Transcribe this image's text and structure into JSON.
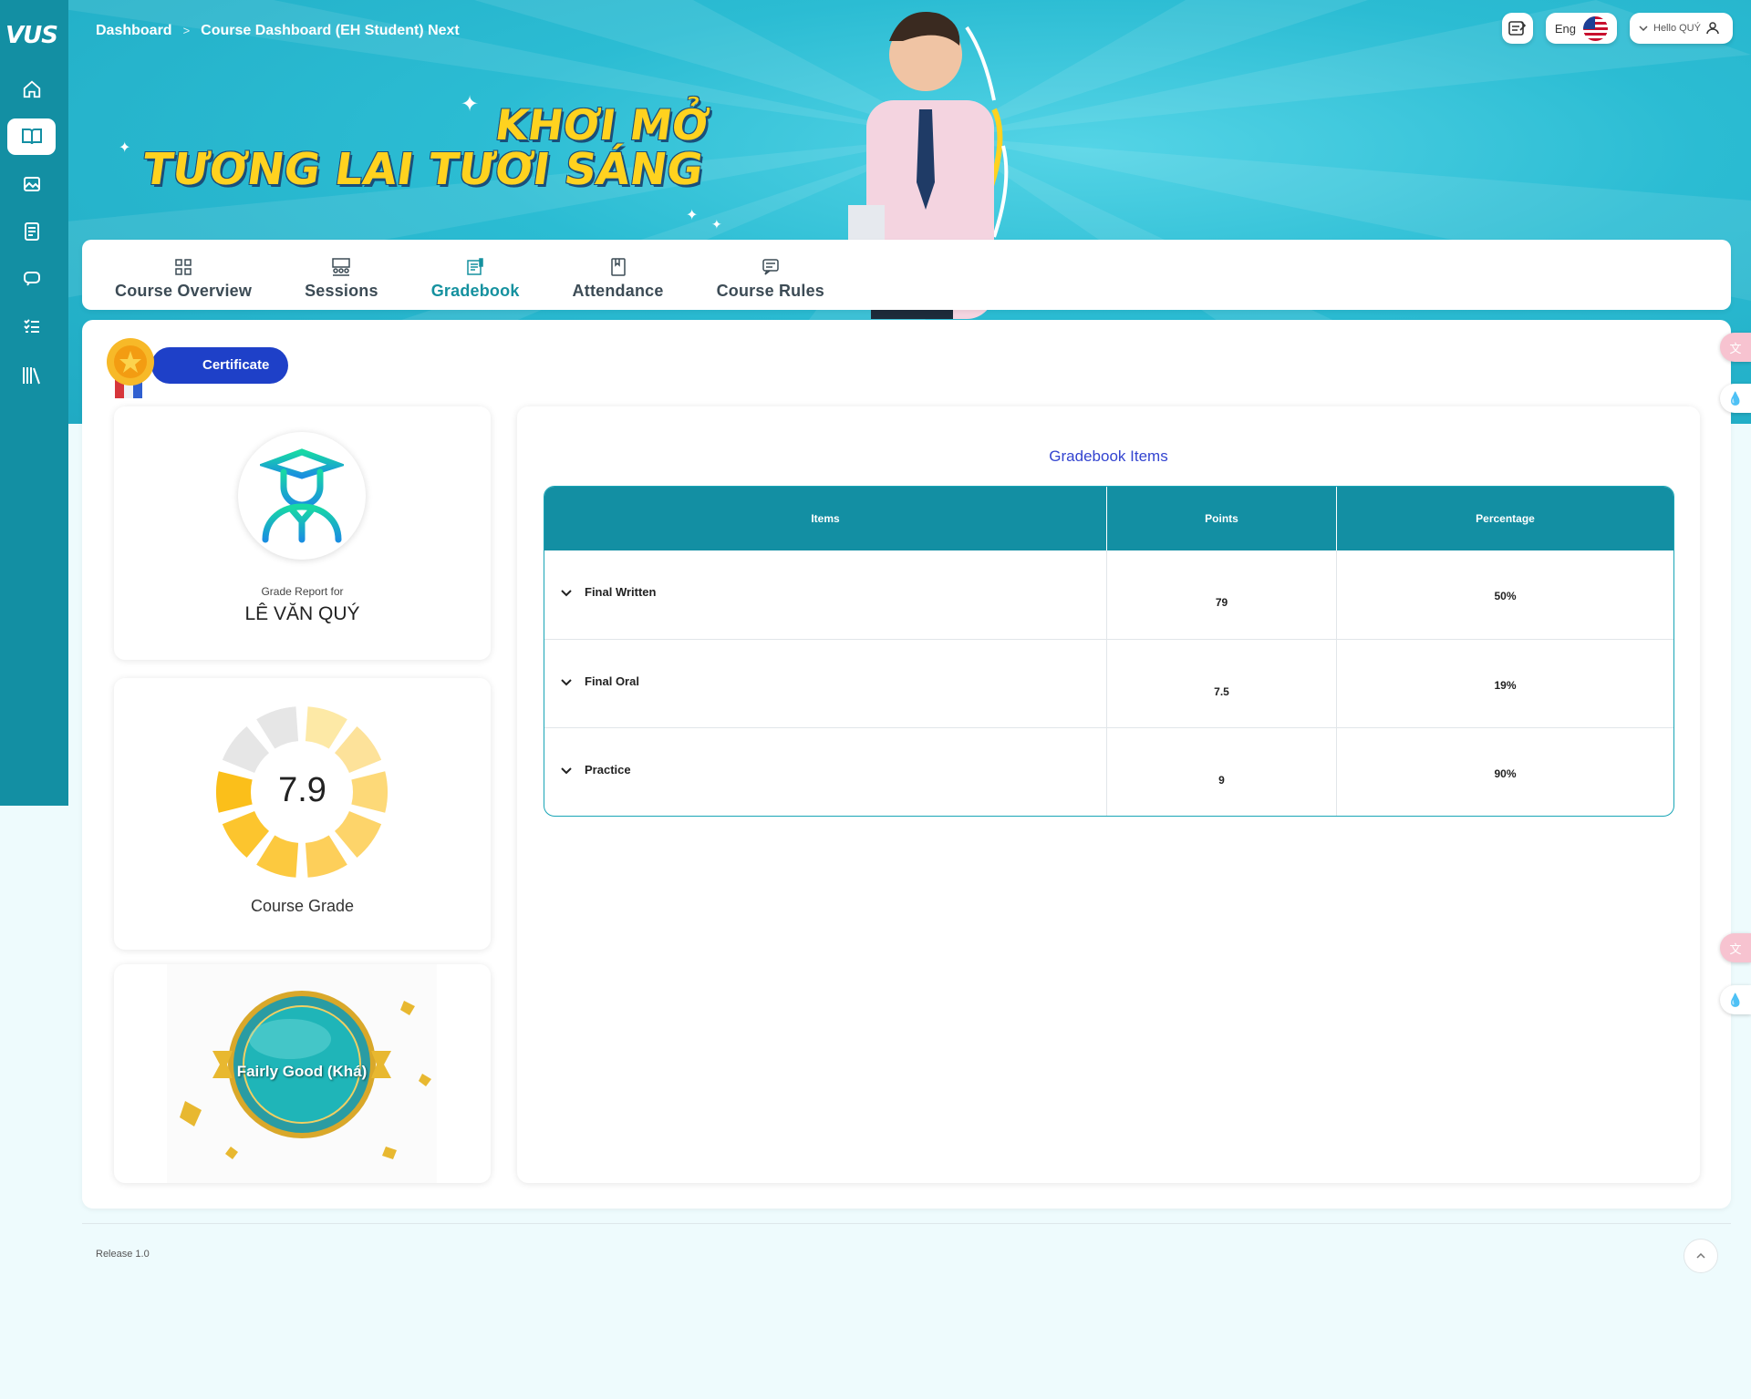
{
  "app": {
    "logo_text": "VUS"
  },
  "breadcrumb": {
    "items": [
      "Dashboard",
      "Course Dashboard (EH Student) Next"
    ],
    "separator": ">"
  },
  "header": {
    "language": "Eng",
    "greeting": "Hello QUÝ"
  },
  "banner": {
    "line1": "KHƠI MỞ",
    "line2": "TƯƠNG LAI TƯƠI SÁNG"
  },
  "sidebar": {
    "items": [
      "home-icon",
      "course-book-icon",
      "gallery-icon",
      "document-icon",
      "chat-icon",
      "checklist-icon",
      "library-icon"
    ],
    "active_index": 1
  },
  "tabs": [
    {
      "label": "Course Overview",
      "icon": "grid-icon"
    },
    {
      "label": "Sessions",
      "icon": "class-icon"
    },
    {
      "label": "Gradebook",
      "icon": "gradebook-icon",
      "active": true
    },
    {
      "label": "Attendance",
      "icon": "book-icon"
    },
    {
      "label": "Course Rules",
      "icon": "message-icon"
    }
  ],
  "certificate": {
    "label": "Certificate"
  },
  "student_card": {
    "caption": "Grade Report for",
    "name": "LÊ VĂN QUÝ"
  },
  "grade_card": {
    "value": "7.9",
    "label": "Course Grade",
    "score": 7.9,
    "max": 10
  },
  "award": {
    "text": "Fairly Good (Khá)"
  },
  "gradebook": {
    "title": "Gradebook Items",
    "columns": [
      "Items",
      "Points",
      "Percentage"
    ],
    "rows": [
      {
        "item": "Final Written",
        "points": "79",
        "percentage": "50%"
      },
      {
        "item": "Final Oral",
        "points": "7.5",
        "percentage": "19%"
      },
      {
        "item": "Practice",
        "points": "9",
        "percentage": "90%"
      }
    ]
  },
  "footer": {
    "release": "Release 1.0"
  },
  "colors": {
    "primary": "#138fa3",
    "accent_blue": "#1e40c8",
    "title_blue": "#3344d0",
    "gold": "#ffc400"
  }
}
